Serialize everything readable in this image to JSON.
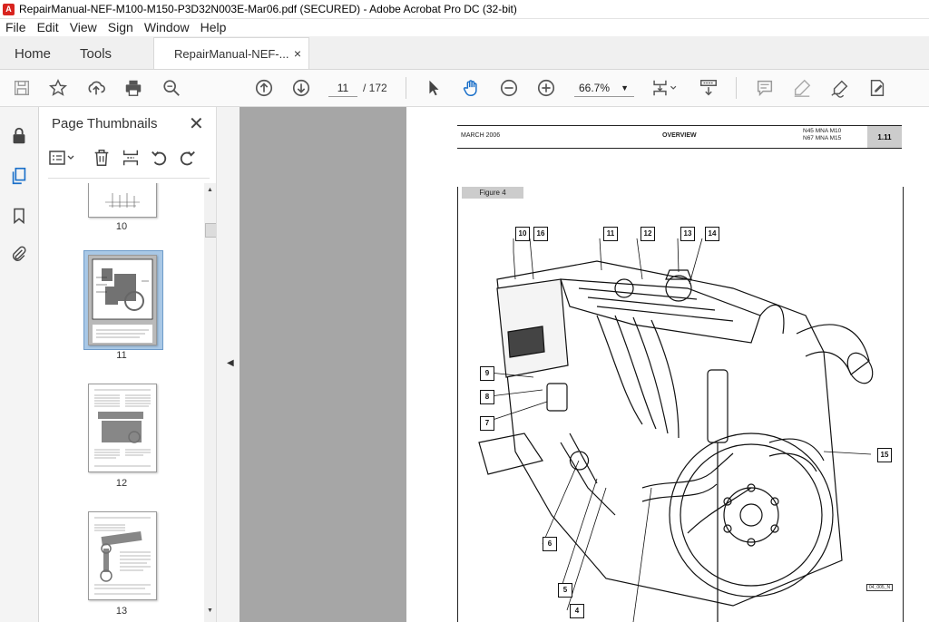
{
  "window": {
    "title": "RepairManual-NEF-M100-M150-P3D32N003E-Mar06.pdf (SECURED) - Adobe Acrobat Pro DC (32-bit)"
  },
  "menu": [
    "File",
    "Edit",
    "View",
    "Sign",
    "Window",
    "Help"
  ],
  "tabs": {
    "home": "Home",
    "tools": "Tools",
    "document": "RepairManual-NEF-...",
    "close": "×"
  },
  "toolbar": {
    "current_page": "11",
    "total_pages": "/ 172",
    "zoom": "66.7%"
  },
  "panel": {
    "title": "Page Thumbnails",
    "close": "✕",
    "thumbnails": [
      {
        "label": "10"
      },
      {
        "label": "11",
        "selected": true
      },
      {
        "label": "12"
      },
      {
        "label": "13"
      }
    ]
  },
  "page": {
    "header_date": "MARCH 2006",
    "header_section": "OVERVIEW",
    "header_model_1": "N45 MNA M10",
    "header_model_2": "N67 MNA M15",
    "page_number": "1.11",
    "figure_label": "Figure 4",
    "figure_ref": "04_005_N",
    "callouts": [
      "10",
      "16",
      "11",
      "12",
      "13",
      "14",
      "9",
      "8",
      "7",
      "15",
      "6",
      "5",
      "4"
    ]
  },
  "colors": {
    "acrobat_red": "#d8241f",
    "selection": "#a9c8e6",
    "gutter": "#a6a6a6"
  }
}
